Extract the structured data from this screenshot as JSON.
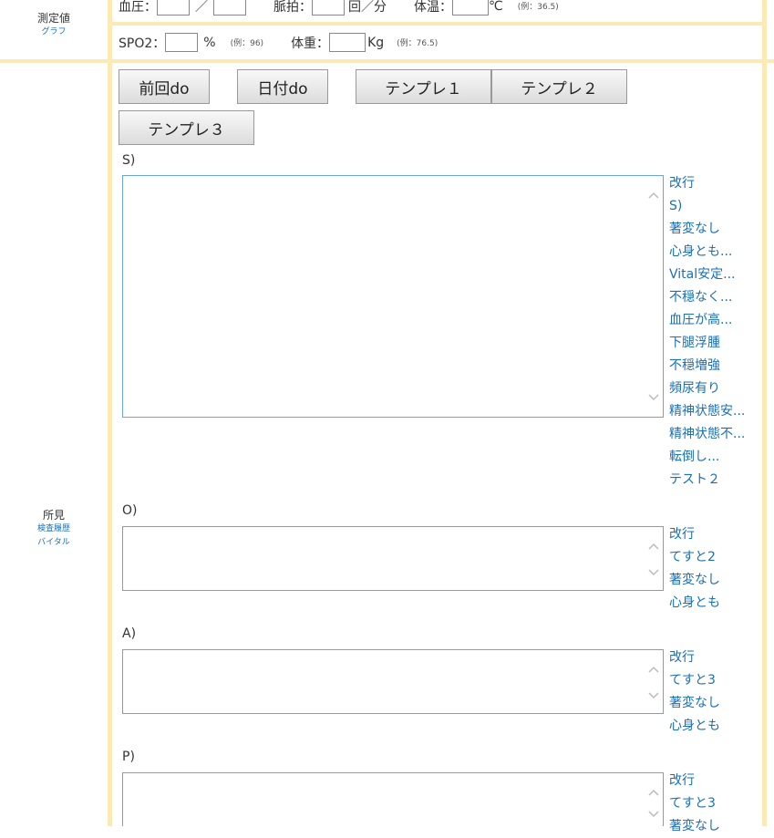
{
  "measurements": {
    "label": "測定値",
    "graph_link": "グラフ",
    "bp_label": "血圧：",
    "bp_sep": "／",
    "pulse_label": "脈拍：",
    "pulse_unit": "回／分",
    "temp_label": "体温：",
    "temp_unit": "℃",
    "temp_example": "(例：36.5)",
    "spo2_label": "SPO2：",
    "spo2_unit": "%",
    "spo2_example": "(例：96)",
    "weight_label": "体重：",
    "weight_unit": "Kg",
    "weight_example": "(例：76.5)"
  },
  "findings": {
    "label": "所見",
    "link_exam": "検査履歴",
    "link_vital": "バイタル"
  },
  "buttons": {
    "prev_do": "前回do",
    "date_do": "日付do",
    "template1": "テンプレ１",
    "template2": "テンプレ２",
    "template3": "テンプレ３"
  },
  "sections": {
    "s_label": "S)",
    "o_label": "O)",
    "a_label": "A)",
    "p_label": "P)"
  },
  "s_phrases": [
    "改行",
    "S)",
    "著変なし",
    "心身とも...",
    "Vital安定...",
    "不穏なく...",
    "血圧が高...",
    "下腿浮腫",
    "不穏増強",
    "頻尿有り",
    "精神状態安...",
    "精神状態不...",
    "転倒し...",
    "テスト２"
  ],
  "o_phrases": [
    "改行",
    "てすと2",
    "著変なし",
    "心身とも"
  ],
  "a_phrases": [
    "改行",
    "てすと3",
    "著変なし",
    "心身とも"
  ],
  "p_phrases": [
    "改行",
    "てすと3",
    "著変なし"
  ],
  "colors": {
    "divider": "#fbe9b6",
    "link": "#1a6fb5"
  }
}
